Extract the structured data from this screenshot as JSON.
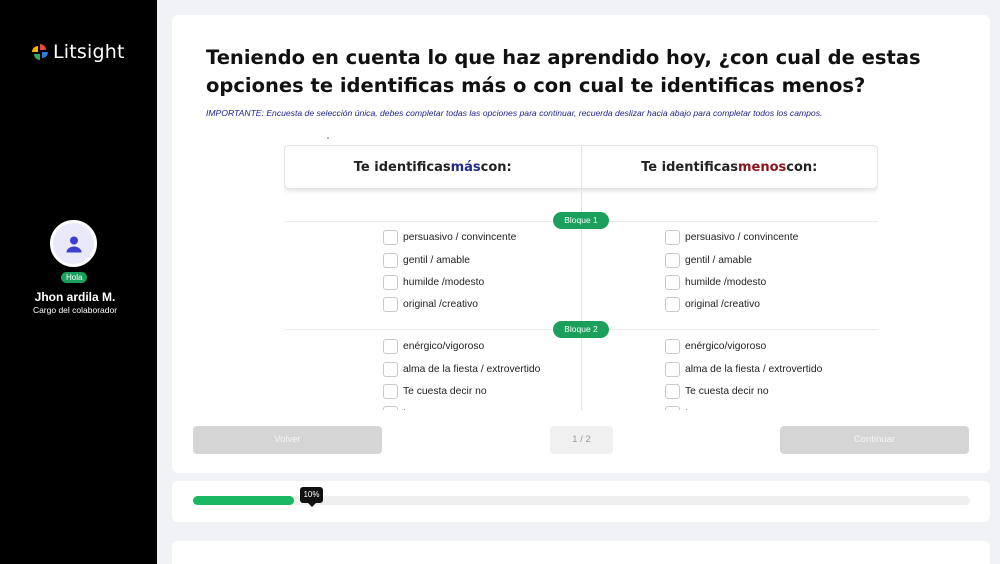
{
  "sidebar": {
    "logo_text": "Litsight",
    "badge": "Hola",
    "user_name": "Jhon ardila M.",
    "user_role": "Cargo del colaborador"
  },
  "main": {
    "title": "Teniendo en cuenta lo que haz aprendido hoy, ¿con cual de estas opciones te identificas más o con cual te identificas menos?",
    "important": "IMPORTANTE: Encuesta de selección única, debes completar todas las opciones para continuar, recuerda deslizar hacia abajo para completar todos los campos.",
    "col_mas": {
      "prefix": "Te identificas ",
      "emph": "más",
      "suffix": " con:"
    },
    "col_menos": {
      "prefix": "Te identificas ",
      "emph": "menos",
      "suffix": " con:"
    },
    "blocks": [
      {
        "label": "Bloque 1",
        "options": [
          "persuasivo / convincente",
          "gentil / amable",
          "humilde /modesto",
          "original /creativo"
        ]
      },
      {
        "label": "Bloque 2",
        "options": [
          "enérgico/vigoroso",
          "alma de la fiesta / extrovertido",
          "Te cuesta decir no",
          "temeroso"
        ]
      }
    ],
    "back_label": "Volver",
    "page_indicator": "1 / 2",
    "continue_label": "Continuar"
  },
  "progress": {
    "label": "10%",
    "value": 0.13
  },
  "colors": {
    "accent_green": "#1aa05a",
    "mas_color": "#1f2a8a",
    "menos_color": "#8a1620"
  }
}
